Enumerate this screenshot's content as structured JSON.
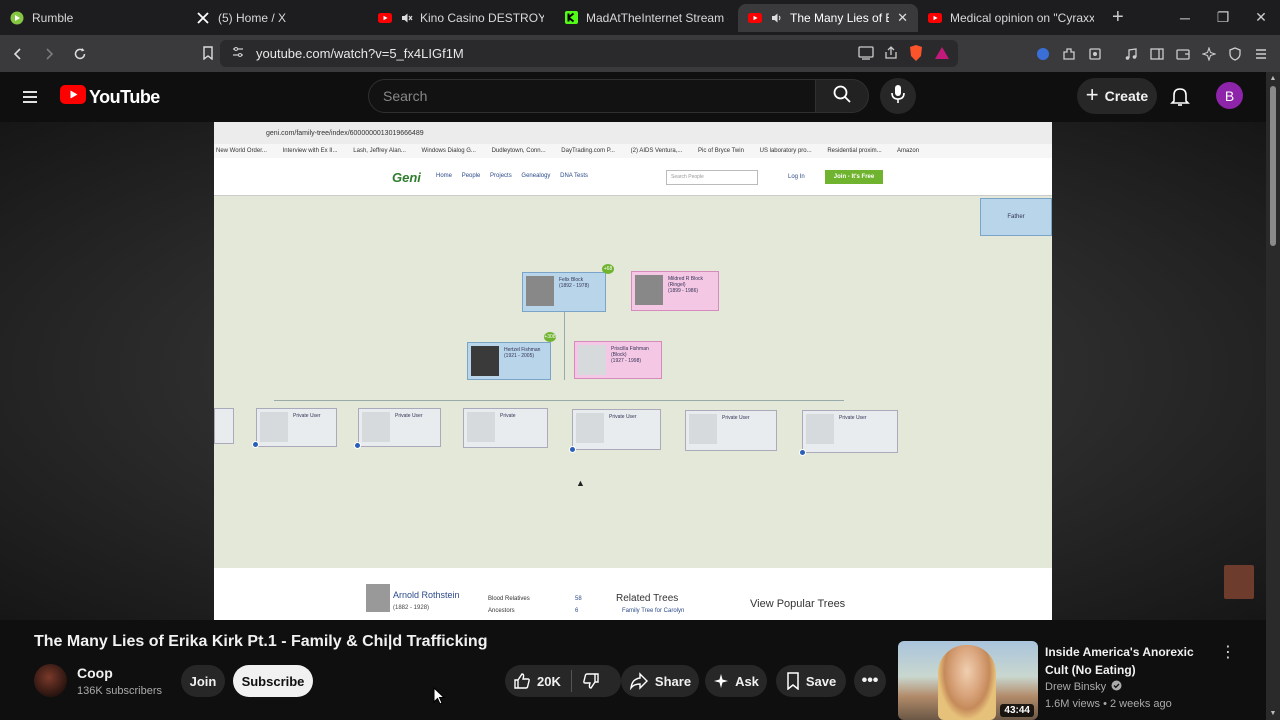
{
  "browser": {
    "tabs": [
      {
        "title": "Rumble",
        "icon": "rumble-icon",
        "active": false
      },
      {
        "title": "(5) Home / X",
        "icon": "x-icon",
        "active": false
      },
      {
        "title": "Kino Casino DESTROYS DSP",
        "icon": "youtube-icon",
        "active": false
      },
      {
        "title": "MadAtTheInternet Stream -",
        "icon": "kick-icon",
        "active": false
      },
      {
        "title": "The Many Lies of Erika K",
        "icon": "youtube-icon",
        "active": true
      },
      {
        "title": "Medical opinion on \"Cyraxx\"'s m",
        "icon": "youtube-icon",
        "active": false
      }
    ],
    "url": "youtube.com/watch?v=5_fx4LIGf1M"
  },
  "youtube": {
    "logo_text": "YouTube",
    "search_placeholder": "Search",
    "create_label": "Create",
    "avatar_letter": "B"
  },
  "video_content": {
    "inner_url": "geni.com/family-tree/index/6000000013019666489",
    "bookmarks": [
      "New World Order...",
      "Interview with Ex II...",
      "Lash, Jeffrey Alan...",
      "Windows Dialog G...",
      "Dudleytown, Conn...",
      "DayTrading.com P...",
      "(2) AIDS Ventura,...",
      "Pic of Bryce Twin",
      "US laboratory pro...",
      "Residential proxim...",
      "Amazon"
    ],
    "site_logo": "Geni",
    "nav_links": [
      "Home",
      "People",
      "Projects",
      "Genealogy",
      "DNA Tests"
    ],
    "search_placeholder": "Search People",
    "login": "Log In",
    "join": "Join - It's Free",
    "father_label": "Father",
    "people": [
      {
        "name": "Felix Block",
        "years": "(1892 - 1978)"
      },
      {
        "name": "Mildred R Block (Ringel)",
        "years": "(1899 - 1986)"
      },
      {
        "name": "Hertzel Fishman",
        "years": "(1921 - 2005)"
      },
      {
        "name": "Priscilla Fishman (Block)",
        "years": "(1927 - 1998)"
      }
    ],
    "badges": [
      "+68",
      "+308"
    ],
    "private_users": [
      "Private User",
      "Private User",
      "Private",
      "Private User",
      "Private User",
      "Private User"
    ],
    "profile_name": "Arnold Rothstein",
    "profile_years": "(1882 - 1928)",
    "relatives": [
      {
        "label": "Blood Relatives",
        "value": "58"
      },
      {
        "label": "Ancestors",
        "value": "6"
      }
    ],
    "related_trees_title": "Related Trees",
    "related_tree_link": "Family Tree for Carolyn",
    "popular_trees_title": "View Popular Trees"
  },
  "video": {
    "title": "The Many Lies of Erika Kirk Pt.1 - Family & Chi|d Trafficking",
    "channel": "Coop",
    "subscribers": "136K subscribers",
    "join_label": "Join",
    "subscribe_label": "Subscribe",
    "likes": "20K",
    "share_label": "Share",
    "ask_label": "Ask",
    "save_label": "Save"
  },
  "recommendation": {
    "title": "Inside America's Anorexic Cult (No Eating)",
    "channel": "Drew Binsky",
    "meta": "1.6M views • 2 weeks ago",
    "duration": "43:44"
  },
  "colors": {
    "youtube_red": "#ff0000",
    "avatar_purple": "#8e24aa",
    "geni_green": "#6fb32f"
  }
}
